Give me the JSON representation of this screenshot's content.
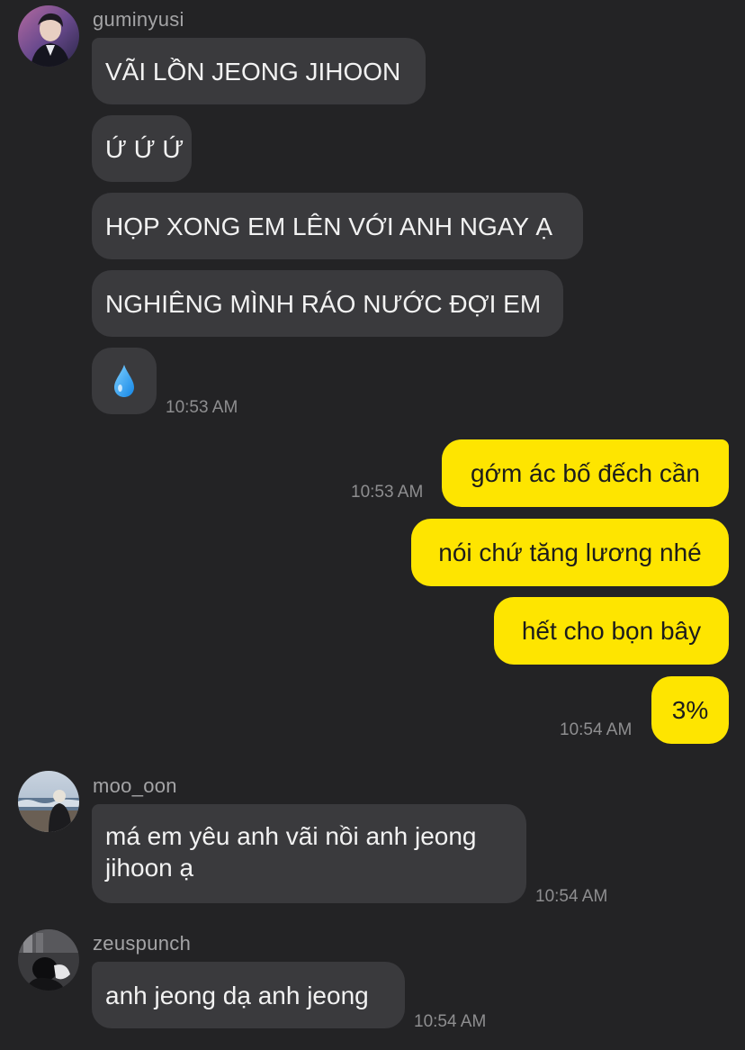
{
  "groups": [
    {
      "sender": "guminyusi",
      "messages": [
        "VÃI LỒN JEONG JIHOON",
        "Ứ Ứ Ứ",
        "HỌP XONG EM LÊN VỚI ANH NGAY Ạ",
        "NGHIÊNG MÌNH RÁO NƯỚC ĐỢI EM",
        "💧"
      ],
      "time": "10:53 AM"
    },
    {
      "sender": "me",
      "messages": [
        "gớm ác bố đếch cần",
        "nói chứ tăng lương nhé",
        "hết cho bọn bây",
        "3%"
      ],
      "time_first": "10:53 AM",
      "time_last": "10:54 AM"
    },
    {
      "sender": "moo_oon",
      "messages": [
        "má em yêu anh vãi nồi anh jeong jihoon ạ"
      ],
      "time": "10:54 AM"
    },
    {
      "sender": "zeuspunch",
      "messages": [
        "anh jeong dạ anh jeong"
      ],
      "time": "10:54 AM"
    }
  ],
  "colors": {
    "background": "#232325",
    "incoming_bubble": "#3a3a3d",
    "outgoing_bubble": "#fee500",
    "timestamp": "#8e8e90",
    "sender_name": "#a4a4a6"
  },
  "icons": {
    "water_drop": "water-drop-icon"
  }
}
